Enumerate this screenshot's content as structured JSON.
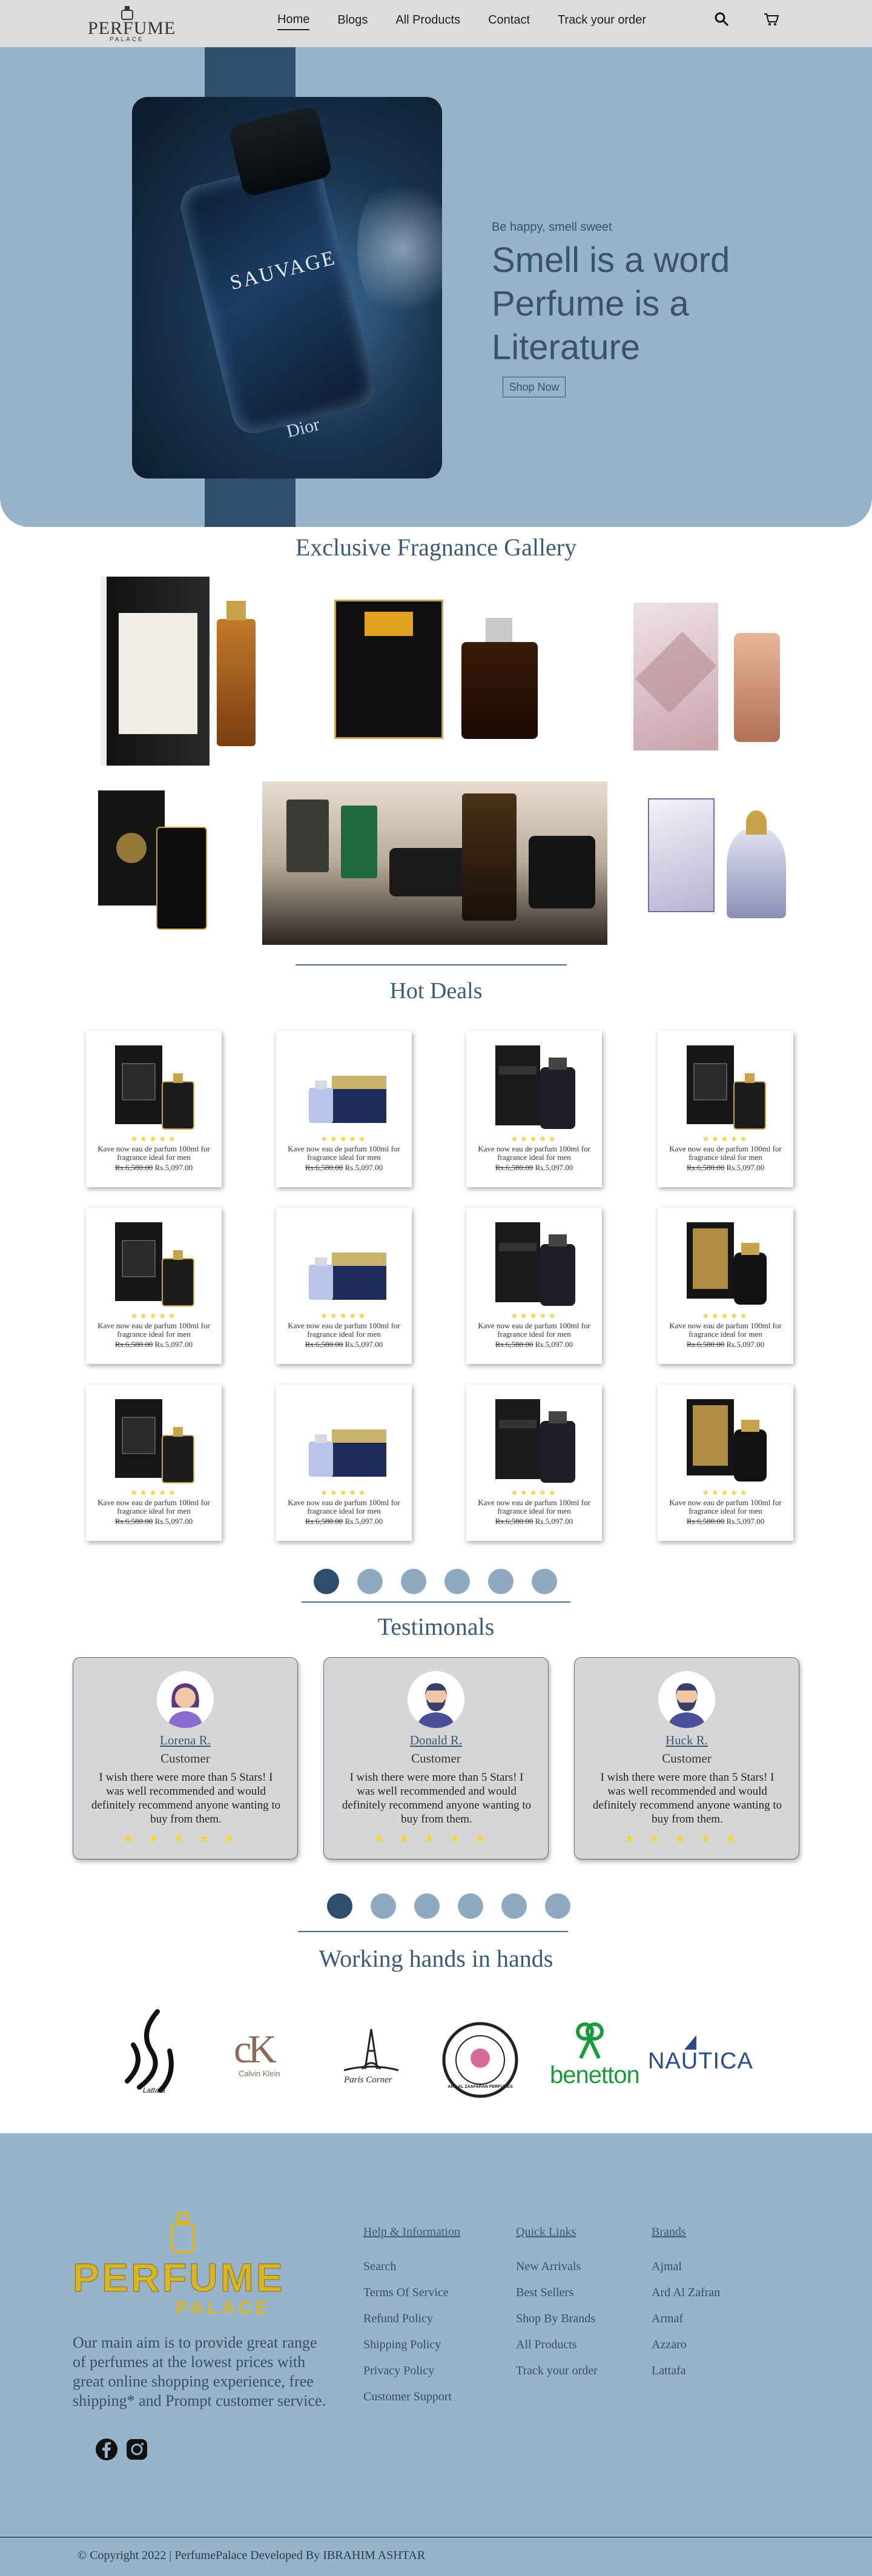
{
  "nav": {
    "logo_text": "PERFUME",
    "logo_sub": "PALACE",
    "links": [
      "Home",
      "Blogs",
      "All Products",
      "Contact",
      "Track your order"
    ],
    "active": "Home"
  },
  "hero": {
    "bottle_label": "SAUVAGE",
    "bottle_brand": "Dior",
    "tagline": "Be happy, smell sweet",
    "title_lines": [
      "Smell is a word",
      "Perfume is a",
      "Literature"
    ],
    "button": "Shop Now"
  },
  "gallery": {
    "title": "Exclusive Fragnance Gallery"
  },
  "hot_deals": {
    "title": "Hot Deals",
    "products": [
      {
        "title": "Kave now eau de parfum 100ml for fragrance ideal for men",
        "old_price": "Rs.6,580.00",
        "price": "Rs.5,097.00",
        "stars": "★★★★★",
        "style": "lattafa"
      },
      {
        "title": "Kave now eau de parfum 100ml for fragrance ideal for men",
        "old_price": "Rs.6,580.00",
        "price": "Rs.5,097.00",
        "stars": "★★★★★",
        "style": "blue"
      },
      {
        "title": "Kave now eau de parfum 100ml for fragrance ideal for men",
        "old_price": "Rs.6,580.00",
        "price": "Rs.5,097.00",
        "stars": "★★★★★",
        "style": "hunter"
      },
      {
        "title": "Kave now eau de parfum 100ml for fragrance ideal for men",
        "old_price": "Rs.6,580.00",
        "price": "Rs.5,097.00",
        "stars": "★★★★★",
        "style": "lattafa"
      },
      {
        "title": "Kave now eau de parfum 100ml for fragrance ideal for men",
        "old_price": "Rs.6,580.00",
        "price": "Rs.5,097.00",
        "stars": "★★★★★",
        "style": "lattafa"
      },
      {
        "title": "Kave now eau de parfum 100ml for fragrance ideal for men",
        "old_price": "Rs.6,580.00",
        "price": "Rs.5,097.00",
        "stars": "★★★★★",
        "style": "blue"
      },
      {
        "title": "Kave now eau de parfum 100ml for fragrance ideal for men",
        "old_price": "Rs.6,580.00",
        "price": "Rs.5,097.00",
        "stars": "★★★★★",
        "style": "hunter"
      },
      {
        "title": "Kave now eau de parfum 100ml for fragrance ideal for men",
        "old_price": "Rs.6,580.00",
        "price": "Rs.5,097.00",
        "stars": "★★★★★",
        "style": "gold"
      },
      {
        "title": "Kave now eau de parfum 100ml for fragrance ideal for men",
        "old_price": "Rs.6,580.00",
        "price": "Rs.5,097.00",
        "stars": "★★★★★",
        "style": "lattafa"
      },
      {
        "title": "Kave now eau de parfum 100ml for fragrance ideal for men",
        "old_price": "Rs.6,580.00",
        "price": "Rs.5,097.00",
        "stars": "★★★★★",
        "style": "blue"
      },
      {
        "title": "Kave now eau de parfum 100ml for fragrance ideal for men",
        "old_price": "Rs.6,580.00",
        "price": "Rs.5,097.00",
        "stars": "★★★★★",
        "style": "hunter"
      },
      {
        "title": "Kave now eau de parfum 100ml for fragrance ideal for men",
        "old_price": "Rs.6,580.00",
        "price": "Rs.5,097.00",
        "stars": "★★★★★",
        "style": "gold"
      }
    ]
  },
  "testimonials": {
    "title": "Testimonals",
    "items": [
      {
        "name": "Lorena R.",
        "role": "Customer",
        "text": "I wish there were more than 5 Stars! I was well recommended and would definitely recommend anyone wanting to buy from them.",
        "stars": "★★★★★"
      },
      {
        "name": "Donald R.",
        "role": "Customer",
        "text": "I wish there were more than 5 Stars! I was well recommended and would definitely recommend anyone wanting to buy from them.",
        "stars": "★★★★★"
      },
      {
        "name": "Huck R.",
        "role": "Customer",
        "text": "I wish there were more than 5 Stars! I was well recommended and would definitely recommend anyone wanting to buy from them.",
        "stars": "★★★★★"
      }
    ]
  },
  "partners": {
    "title": "Working hands in hands",
    "brands": [
      "Lattafa",
      "Calvin Klein",
      "Paris Corner",
      "ARD AL ZAAFARAN PERFUMES",
      "benetton",
      "NAUTICA"
    ]
  },
  "footer": {
    "logo_text": "PERFUME",
    "logo_sub": "PALACE",
    "description": "Our main aim is to provide great range of perfumes at the lowest prices with great online shopping experience, free shipping* and Prompt customer service.",
    "columns": [
      {
        "heading": "Help & Information",
        "links": [
          "Search",
          "Terms Of Service",
          "Refund Policy",
          "Shipping Policy",
          "Privacy Policy",
          "Customer Support"
        ]
      },
      {
        "heading": "Quick Links",
        "links": [
          "New Arrivals",
          "Best Sellers",
          "Shop By Brands",
          "All Products",
          "Track your order"
        ]
      },
      {
        "heading": "Brands",
        "links": [
          "Ajmal",
          "Ard Al Zafran",
          "Armaf",
          "Azzaro",
          "Lattafa"
        ]
      }
    ],
    "copyright": "© Copyright 2022 | PerfumePalace Developed By IBRAHIM ASHTAR"
  },
  "colors": {
    "hero_bg": "#96b3cb",
    "accent_dark": "#2f4e6c",
    "footer_bg": "#97b4cb",
    "star": "#f0d54a"
  }
}
